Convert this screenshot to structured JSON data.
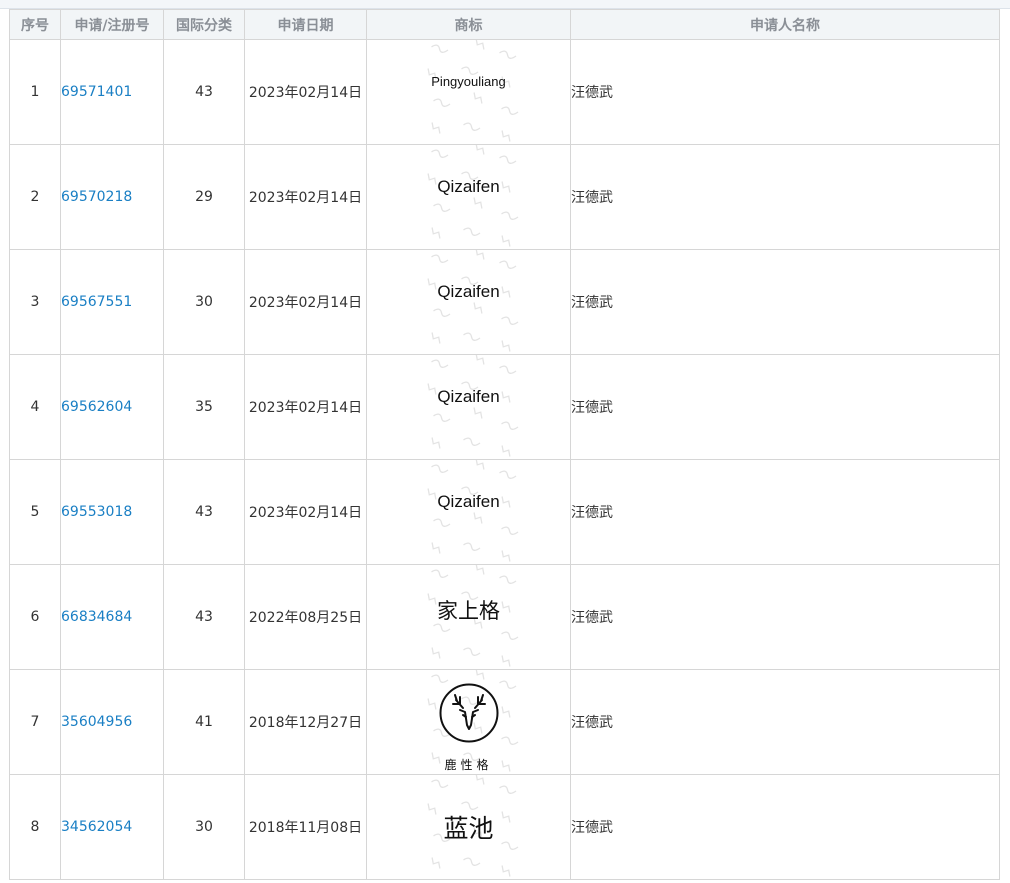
{
  "table": {
    "headers": {
      "index": "序号",
      "number": "申请/注册号",
      "class": "国际分类",
      "date": "申请日期",
      "mark": "商标",
      "owner": "申请人名称"
    },
    "rows": [
      {
        "index": "1",
        "number": "69571401",
        "class": "43",
        "date": "2023年02月14日",
        "mark": "Pingyouliang",
        "owner": "汪德武"
      },
      {
        "index": "2",
        "number": "69570218",
        "class": "29",
        "date": "2023年02月14日",
        "mark": "Qizaifen",
        "owner": "汪德武"
      },
      {
        "index": "3",
        "number": "69567551",
        "class": "30",
        "date": "2023年02月14日",
        "mark": "Qizaifen",
        "owner": "汪德武"
      },
      {
        "index": "4",
        "number": "69562604",
        "class": "35",
        "date": "2023年02月14日",
        "mark": "Qizaifen",
        "owner": "汪德武"
      },
      {
        "index": "5",
        "number": "69553018",
        "class": "43",
        "date": "2023年02月14日",
        "mark": "Qizaifen",
        "owner": "汪德武"
      },
      {
        "index": "6",
        "number": "66834684",
        "class": "43",
        "date": "2022年08月25日",
        "mark": "家上格",
        "owner": "汪德武"
      },
      {
        "index": "7",
        "number": "35604956",
        "class": "41",
        "date": "2018年12月27日",
        "mark": "鹿性格",
        "mark_icon": "deer-head-logo-icon",
        "owner": "汪德武"
      },
      {
        "index": "8",
        "number": "34562054",
        "class": "30",
        "date": "2018年11月08日",
        "mark": "蓝池",
        "owner": "汪德武"
      }
    ]
  },
  "colors": {
    "link": "#1a7fc4",
    "header_bg": "#f2f5f7",
    "header_text": "#8a8f96",
    "border": "#d6d6d6",
    "watermark": "#e3e3e3"
  }
}
